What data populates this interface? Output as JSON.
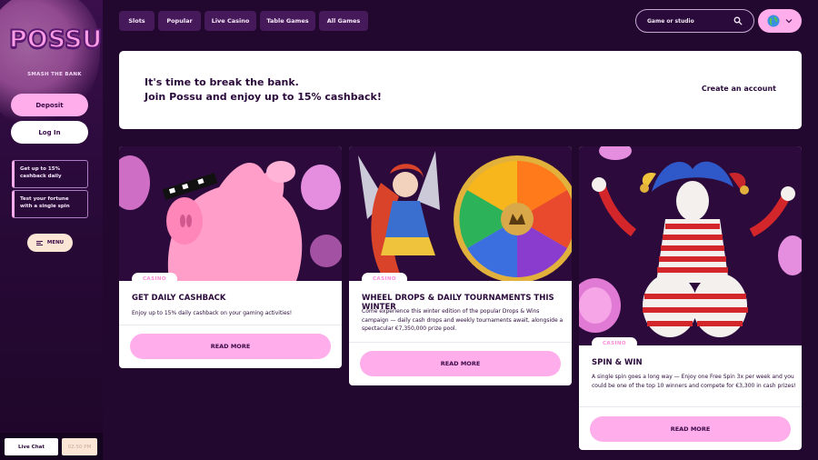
{
  "brand": {
    "logo_text": "POSSU",
    "tagline": "SMASH THE BANK"
  },
  "sidebar": {
    "deposit_label": "Deposit",
    "login_label": "Log In",
    "promos": [
      {
        "label": "Get up to 15% cashback daily"
      },
      {
        "label": "Test your fortune with a single spin"
      }
    ],
    "menu_label": "MENU",
    "livechat_label": "Live Chat",
    "clock": "02:50 PM"
  },
  "nav": {
    "tabs": [
      {
        "label": "Slots"
      },
      {
        "label": "Popular"
      },
      {
        "label": "Live Casino"
      },
      {
        "label": "Table Games"
      },
      {
        "label": "All Games"
      }
    ],
    "search_placeholder": "Game or studio"
  },
  "banner": {
    "line1": "It's time to break the bank.",
    "line2": "Join Possu and enjoy up to 15% cashback!",
    "cta": "Create an account"
  },
  "cards": [
    {
      "badge": "CASINO",
      "title": "GET DAILY CASHBACK",
      "description": "Enjoy up to 15% daily cashback on your gaming activities!",
      "button": "READ MORE"
    },
    {
      "badge": "CASINO",
      "title": "WHEEL DROPS & DAILY TOURNAMENTS THIS WINTER",
      "description": "Come experience this winter edition of the popular Drops & Wins campaign — daily cash drops and weekly tournaments await, alongside a spectacular €7,350,000 prize pool.",
      "button": "READ MORE"
    },
    {
      "badge": "CASINO",
      "title": "SPIN & WIN",
      "description": "A single spin goes a long way — Enjoy one Free Spin 3x per week and you could be one of the top 10 winners and compete for €3,300 in cash prizes!",
      "button": "READ MORE"
    }
  ],
  "colors": {
    "accent_pink": "#ffadeb",
    "background": "#22082f",
    "nav_tab": "#46195a",
    "text_dark": "#2a0a3a"
  },
  "icons": {
    "search": "search-icon",
    "globe": "globe-icon",
    "chevron": "chevron-down-icon",
    "menu": "hamburger-icon"
  }
}
